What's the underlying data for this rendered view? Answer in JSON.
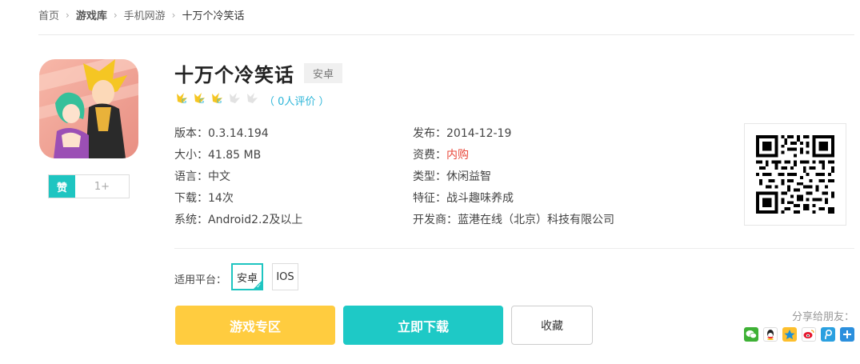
{
  "breadcrumb": {
    "home": "首页",
    "library": "游戏库",
    "category": "手机网游",
    "current": "十万个冷笑话"
  },
  "app": {
    "title": "十万个冷笑话",
    "platform_tag": "安卓",
    "rating": {
      "filled": 3,
      "total": 5,
      "count_text": "（ 0人评价 ）"
    },
    "like_label": "赞",
    "like_count": "1+"
  },
  "info_left": [
    {
      "label": "版本：",
      "value": "0.3.14.194"
    },
    {
      "label": "大小：",
      "value": "41.85 MB"
    },
    {
      "label": "语言：",
      "value": "中文"
    },
    {
      "label": "下载：",
      "value": "14次"
    },
    {
      "label": "系统：",
      "value": "Android2.2及以上"
    }
  ],
  "info_right": [
    {
      "label": "发布：",
      "value": "2014-12-19"
    },
    {
      "label": "资费：",
      "value": "内购"
    },
    {
      "label": "类型：",
      "value": "休闲益智"
    },
    {
      "label": "特征：",
      "value": "战斗趣味养成"
    },
    {
      "label": "开发商：",
      "value": "蓝港在线（北京）科技有限公司"
    }
  ],
  "platform": {
    "label": "适用平台：",
    "options": [
      "安卓",
      "IOS"
    ],
    "selected": "安卓"
  },
  "buttons": {
    "zone": "游戏专区",
    "download": "立即下载",
    "favorite": "收藏"
  },
  "share": {
    "label": "分享给朋友：",
    "icons": [
      "wechat-icon",
      "qq-icon",
      "qzone-icon",
      "weibo-icon",
      "tencent-weibo-icon",
      "more-icon"
    ]
  },
  "colors": {
    "accent": "#1ec5c1",
    "yellow": "#ffcc3f",
    "price_red": "#e8483a",
    "link_blue": "#2bb5d8"
  }
}
